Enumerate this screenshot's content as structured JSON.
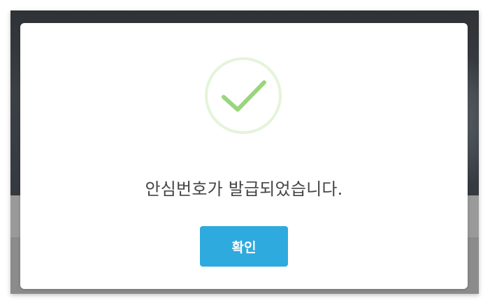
{
  "dialog": {
    "message": "안심번호가 발급되었습니다.",
    "confirm_label": "확인",
    "icon": "check-circle-icon"
  },
  "colors": {
    "accent": "#2eaadf",
    "success": "#9ad57e",
    "success_ring": "#e4f4da",
    "text": "#444444"
  }
}
